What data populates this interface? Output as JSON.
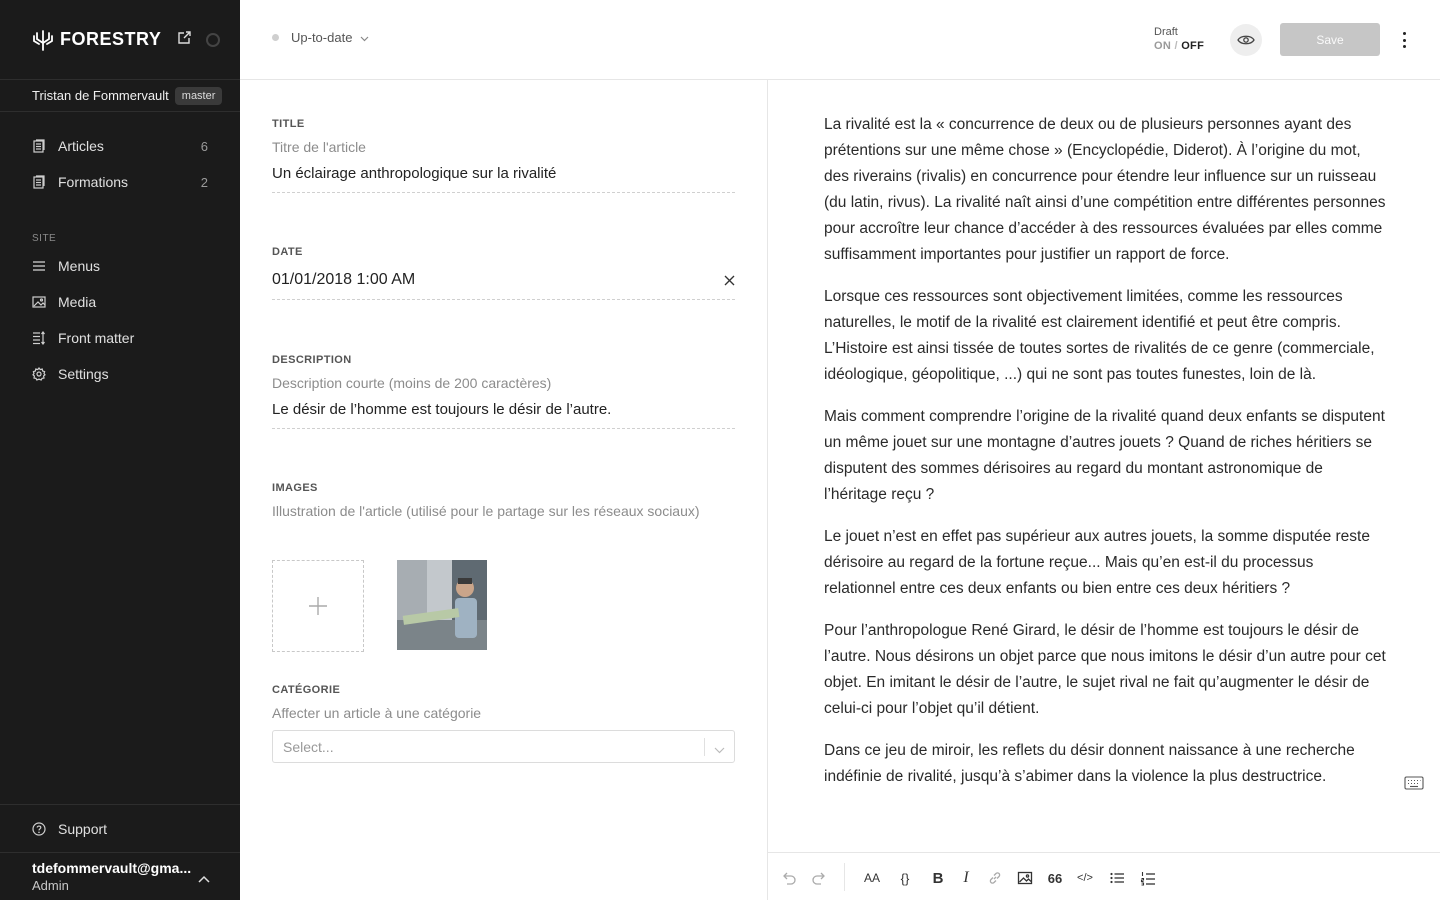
{
  "app": {
    "name": "FORESTRY",
    "user": "Tristan de Fommervault",
    "branch": "master"
  },
  "sidebar": {
    "content_items": [
      {
        "label": "Articles",
        "count": "6",
        "icon": "document-icon"
      },
      {
        "label": "Formations",
        "count": "2",
        "icon": "document-icon"
      }
    ],
    "site_label": "SITE",
    "site_items": [
      {
        "label": "Menus",
        "icon": "menu-icon"
      },
      {
        "label": "Media",
        "icon": "image-icon"
      },
      {
        "label": "Front matter",
        "icon": "front-matter-icon"
      },
      {
        "label": "Settings",
        "icon": "gear-icon"
      }
    ],
    "support": "Support",
    "account": {
      "email": "tdefommervault@gma...",
      "role": "Admin"
    }
  },
  "topbar": {
    "status": "Up-to-date",
    "draft_label": "Draft",
    "draft_on": "ON",
    "draft_sep": "/",
    "draft_off": "OFF",
    "save": "Save"
  },
  "form": {
    "title": {
      "label": "TITLE",
      "help": "Titre de l'article",
      "value": "Un éclairage anthropologique sur la rivalité"
    },
    "date": {
      "label": "DATE",
      "value": "01/01/2018 1:00 AM"
    },
    "description": {
      "label": "DESCRIPTION",
      "help": "Description courte (moins de 200 caractères)",
      "value": "Le désir de l’homme est toujours le désir de l’autre."
    },
    "images": {
      "label": "IMAGES",
      "help": "Illustration de l'article (utilisé pour le partage sur les réseaux sociaux)"
    },
    "category": {
      "label": "CATÉGORIE",
      "help": "Affecter un article à une catégorie",
      "placeholder": "Select..."
    }
  },
  "editor": {
    "paragraphs": [
      "La rivalité est la « concurrence de deux ou de plusieurs personnes ayant des prétentions sur une même chose » (Encyclopédie, Diderot). À l’origine du mot, des riverains (rivalis) en concurrence pour étendre leur influence sur un ruisseau (du latin, rivus). La rivalité naît ainsi d’une compétition entre différentes personnes pour accroître leur chance d’accéder à des ressources évaluées par elles comme suffisamment importantes pour justifier un rapport de force.",
      "Lorsque ces ressources sont objectivement limitées, comme les ressources naturelles, le motif de la rivalité est clairement identifié et peut être compris. L’Histoire est ainsi tissée de toutes sortes de rivalités de ce genre (commerciale, idéologique, géopolitique, ...) qui ne sont pas toutes funestes, loin de là.",
      "Mais comment comprendre l’origine de la rivalité quand deux enfants se disputent un même jouet sur une montagne d’autres jouets ? Quand de riches héritiers se disputent des sommes dérisoires au regard du montant astronomique de l’héritage reçu ?",
      "Le jouet n’est en effet pas supérieur aux autres jouets, la somme disputée reste dérisoire au regard de la fortune reçue... Mais qu’en est-il du processus relationnel entre ces deux enfants ou bien entre ces deux héritiers ?",
      "Pour l’anthropologue René Girard, le désir de l’homme est toujours le désir de l’autre. Nous désirons un objet parce que nous imitons le désir d’un autre pour cet objet. En imitant le désir de l’autre, le sujet rival ne fait qu’augmenter le désir de celui-ci pour l’objet qu’il détient.",
      "Dans ce jeu de miroir, les reflets du désir donnent naissance à une recherche indéfinie de rivalité, jusqu’à s’abimer dans la violence la plus destructrice."
    ],
    "toolbar": {
      "format_glyph": "AA",
      "code_glyph": "{}",
      "bold_glyph": "B",
      "italic_glyph": "I",
      "quote_glyph": "66",
      "inline_code_glyph": "</>"
    }
  }
}
